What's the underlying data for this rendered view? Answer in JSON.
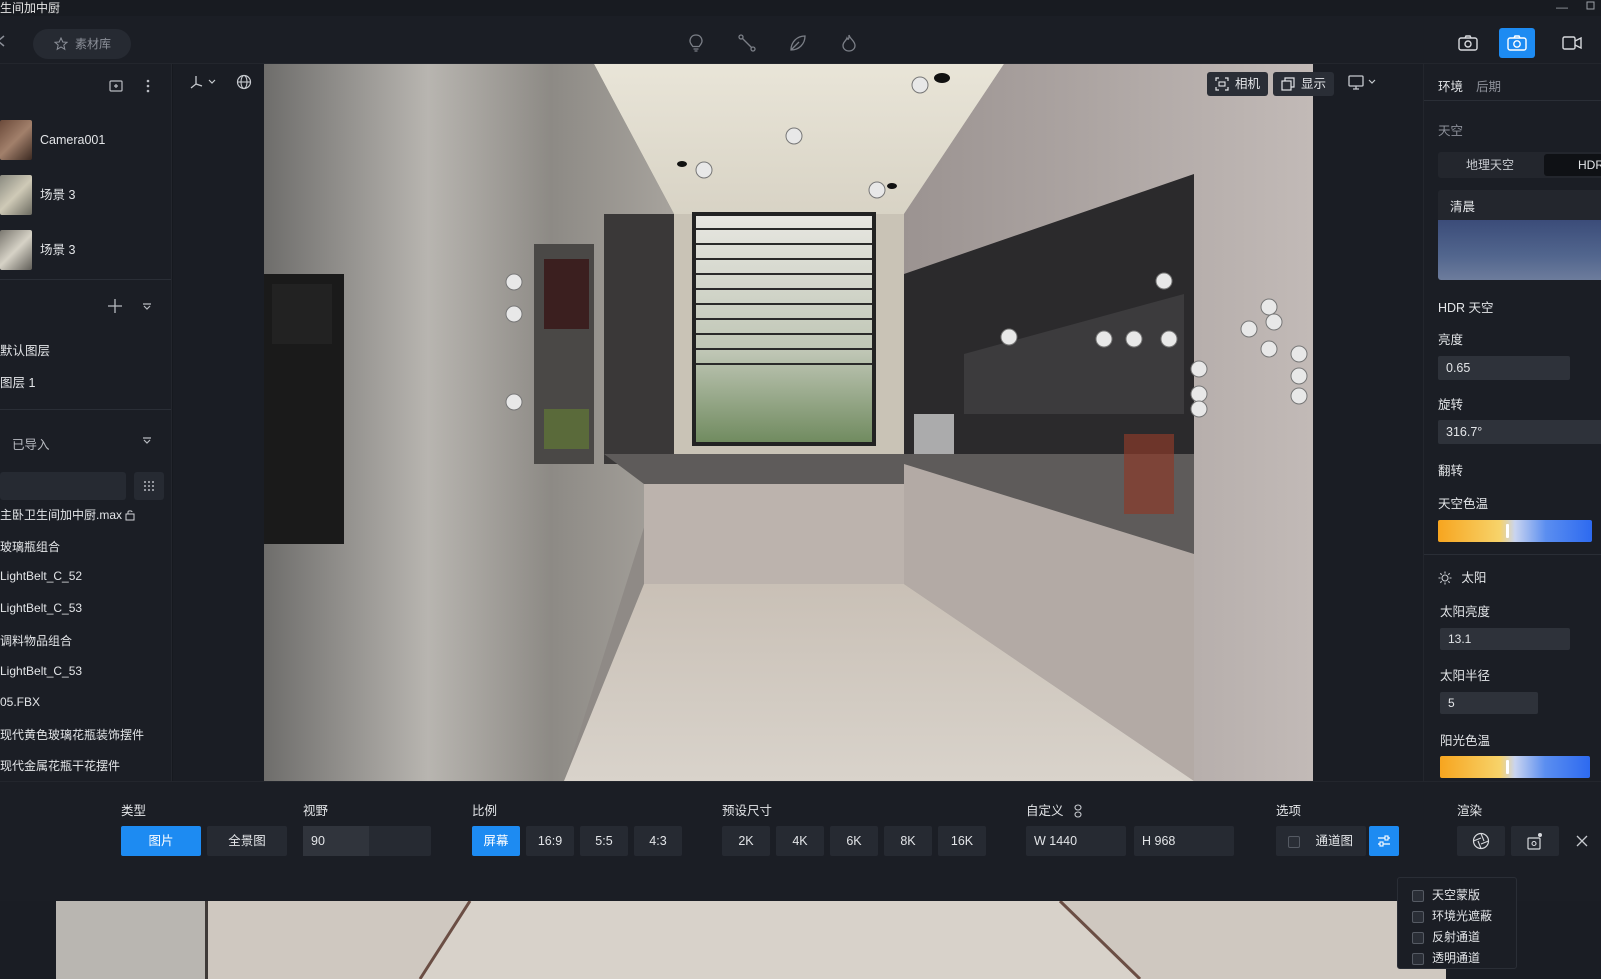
{
  "window": {
    "title": "生间加中厨",
    "minimize_glyph": "—"
  },
  "toolbar": {
    "library_label": "素材库",
    "center_icons": [
      "lightbulb-icon",
      "connect-icon",
      "leaf-icon",
      "flame-icon"
    ],
    "right_icons": [
      "render-camera-icon",
      "camera-icon",
      "video-icon"
    ],
    "active_right": "camera-icon"
  },
  "left_panel": {
    "cameras": [
      {
        "name": "Camera001"
      },
      {
        "name": "场景 3"
      },
      {
        "name": "场景 3"
      }
    ],
    "layers": [
      "默认图层",
      "图层 1"
    ],
    "imported_label": "已导入",
    "files": [
      "主卧卫生间加中厨.max",
      "玻璃瓶组合",
      "LightBelt_C_52",
      "LightBelt_C_53",
      "调料物品组合",
      "LightBelt_C_53",
      "05.FBX",
      "现代黄色玻璃花瓶装饰摆件",
      "现代金属花瓶干花摆件"
    ]
  },
  "viewport": {
    "camera_label": "相机",
    "display_label": "显示"
  },
  "right_panel": {
    "tabs": [
      "环境",
      "后期"
    ],
    "active_tab": "环境",
    "sky_section": "天空",
    "sky_modes": [
      "地理天空",
      "HDR"
    ],
    "active_sky_mode": "HDR",
    "preset_name": "清晨",
    "hdr_sky_label": "HDR 天空",
    "brightness_label": "亮度",
    "brightness_value": "0.65",
    "rotation_label": "旋转",
    "rotation_value": "316.7°",
    "flip_label": "翻转",
    "sky_temp_label": "天空色温",
    "sky_temp_level": 0.44,
    "sun_label": "太阳",
    "sun_brightness_label": "太阳亮度",
    "sun_brightness_value": "13.1",
    "sun_radius_label": "太阳半径",
    "sun_radius_value": "5",
    "sun_temp_label": "阳光色温"
  },
  "bottom_bar": {
    "type_label": "类型",
    "type_options": [
      "图片",
      "全景图"
    ],
    "active_type": "图片",
    "fov_label": "视野",
    "fov_value": "90",
    "ratio_label": "比例",
    "ratio_options": [
      "屏幕",
      "16:9",
      "5:5",
      "4:3"
    ],
    "active_ratio": "屏幕",
    "preset_label": "预设尺寸",
    "preset_options": [
      "2K",
      "4K",
      "6K",
      "8K",
      "16K"
    ],
    "custom_label": "自定义",
    "width_value": "W 1440",
    "height_value": "H 968",
    "options_label": "选项",
    "channel_label": "通道图",
    "render_label": "渲染"
  },
  "options_popup": {
    "items": [
      "天空蒙版",
      "环境光遮蔽",
      "反射通道",
      "透明通道"
    ]
  },
  "colors": {
    "accent": "#1d8bf2",
    "panel": "#1b1e25",
    "background": "#16191f"
  }
}
